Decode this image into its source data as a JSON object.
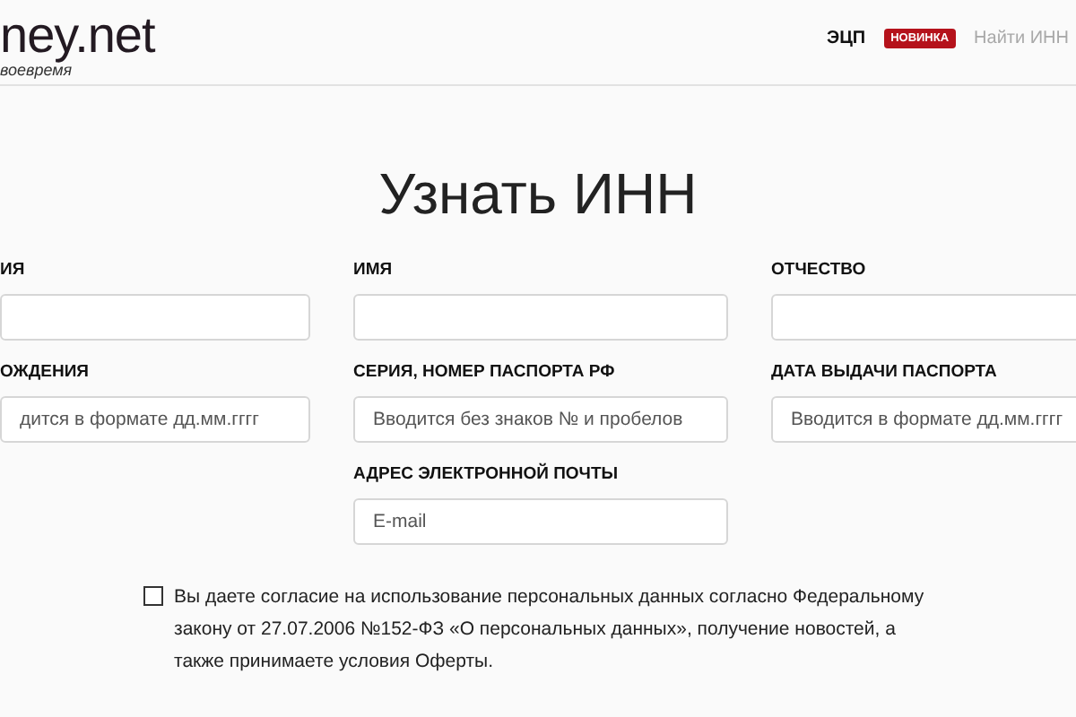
{
  "header": {
    "logo": "ney.net",
    "slogan": "воевремя",
    "nav": [
      {
        "label": "ЭЦП",
        "badge": "НОВИНКА",
        "selected": true
      },
      {
        "label": "Найти ИНН",
        "selected": false
      }
    ]
  },
  "title": "Узнать ИНН",
  "fields": [
    {
      "label": "ИЯ"
    },
    {
      "label": "ИМЯ"
    },
    {
      "label": "ОТЧЕСТВО"
    },
    {
      "label": "ОЖДЕНИЯ",
      "placeholder": "дится в формате дд.мм.гггг"
    },
    {
      "label": "СЕРИЯ, НОМЕР ПАСПОРТА РФ",
      "placeholder": "Вводится без знаков № и пробелов"
    },
    {
      "label": "ДАТА ВЫДАЧИ ПАСПОРТА",
      "placeholder": "Вводится в формате дд.мм.гггг"
    },
    {
      "label": "АДРЕС ЭЛЕКТРОННОЙ ПОЧТЫ",
      "placeholder": "E-mail"
    }
  ],
  "consent": {
    "checked": false,
    "text": "Вы даете согласие на использование персональных данных согласно Федеральному закону от 27.07.2006 №152-ФЗ «О персональных данных», получение новостей, а также принимаете условия Оферты."
  }
}
